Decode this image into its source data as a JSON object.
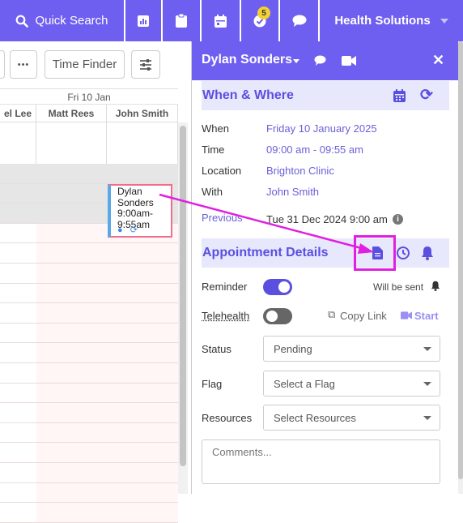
{
  "topbar": {
    "search_label": "Quick Search",
    "tasks_badge": "5",
    "account_label": "Health Solutions"
  },
  "calendar": {
    "time_finder_label": "Time Finder",
    "more_label": "•••",
    "day_header": "Fri 10 Jan",
    "columns": [
      "el Lee",
      "Matt Rees",
      "John Smith"
    ],
    "appointment": {
      "line1": "Dylan",
      "line2": "Sonders",
      "line3": "9:00am-",
      "line4": "9:55am"
    }
  },
  "panel": {
    "patient_name": "Dylan Sonders",
    "when_where": {
      "title": "When & Where",
      "when_label": "When",
      "when_value": "Friday 10 January 2025",
      "time_label": "Time",
      "time_value": "09:00 am - 09:55 am",
      "location_label": "Location",
      "location_value": "Brighton Clinic",
      "with_label": "With",
      "with_value": "John Smith",
      "previous_label": "Previous",
      "previous_value": "Tue 31 Dec 2024 9:00 am"
    },
    "details": {
      "title": "Appointment Details",
      "reminder_label": "Reminder",
      "reminder_on": true,
      "will_be_sent": "Will be sent",
      "telehealth_label": "Telehealth",
      "telehealth_on": false,
      "copy_link": "Copy Link",
      "start": "Start",
      "status_label": "Status",
      "status_value": "Pending",
      "flag_label": "Flag",
      "flag_placeholder": "Select a Flag",
      "resources_label": "Resources",
      "resources_placeholder": "Select Resources",
      "comments_placeholder": "Comments..."
    }
  },
  "colors": {
    "brand": "#6f5ff0",
    "section_bg": "#e8e8fd",
    "highlight": "#e020e0"
  }
}
